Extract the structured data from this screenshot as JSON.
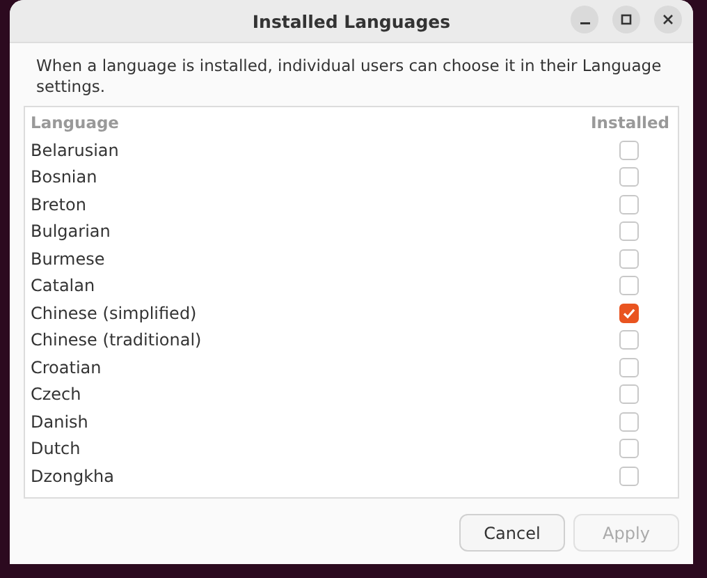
{
  "window": {
    "title": "Installed Languages"
  },
  "description": "When a language is installed, individual users can choose it in their Language settings.",
  "table": {
    "columns": [
      "Language",
      "Installed"
    ],
    "rows": [
      {
        "name": "Belarusian",
        "checked": false
      },
      {
        "name": "Bosnian",
        "checked": false
      },
      {
        "name": "Breton",
        "checked": false
      },
      {
        "name": "Bulgarian",
        "checked": false
      },
      {
        "name": "Burmese",
        "checked": false
      },
      {
        "name": "Catalan",
        "checked": false
      },
      {
        "name": "Chinese (simplified)",
        "checked": true
      },
      {
        "name": "Chinese (traditional)",
        "checked": false
      },
      {
        "name": "Croatian",
        "checked": false
      },
      {
        "name": "Czech",
        "checked": false
      },
      {
        "name": "Danish",
        "checked": false
      },
      {
        "name": "Dutch",
        "checked": false
      },
      {
        "name": "Dzongkha",
        "checked": false
      }
    ]
  },
  "buttons": [
    {
      "label": "Cancel",
      "disabled": false
    },
    {
      "label": "Apply",
      "disabled": true
    }
  ]
}
